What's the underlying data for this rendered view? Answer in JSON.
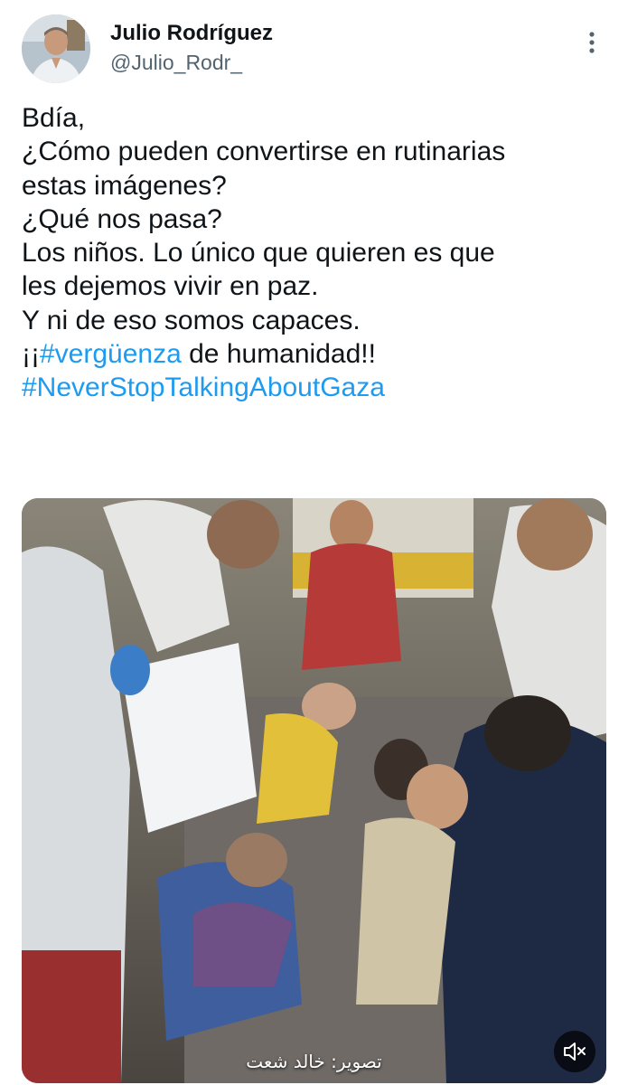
{
  "author": {
    "display_name": "Julio Rodríguez",
    "handle": "@Julio_Rodr_",
    "avatar_icon": "profile-photo"
  },
  "tweet": {
    "lines": [
      "Bdía,",
      "¿Cómo pueden convertirse en rutinarias",
      "estas imágenes?",
      "¿Qué nos pasa?",
      "Los niños. Lo único que quieren es que",
      "les dejemos vivir en paz.",
      "Y ni de eso somos capaces."
    ],
    "hashtag_line": {
      "prefix": "¡¡",
      "hashtag": "#vergüenza",
      "suffix": " de humanidad!!"
    },
    "final_hashtag": "#NeverStopTalkingAboutGaza"
  },
  "media": {
    "type": "video",
    "caption": "تصوير: خالد شعت",
    "mute_icon": "speaker-muted-icon"
  },
  "colors": {
    "text": "#0f1419",
    "secondary": "#536471",
    "link": "#1d9bf0"
  },
  "icons": {
    "more": "more-vertical-icon"
  }
}
